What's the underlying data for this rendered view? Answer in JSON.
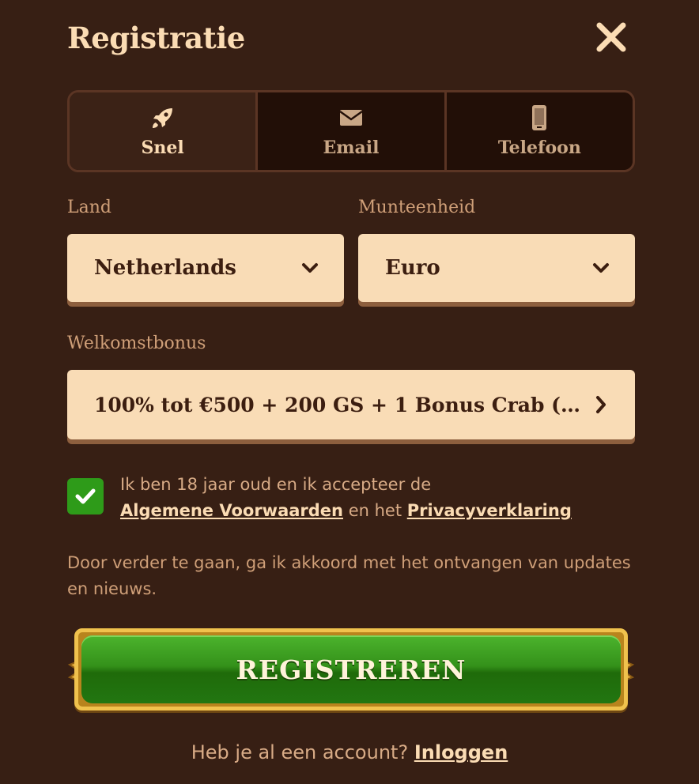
{
  "modal": {
    "title": "Registratie",
    "close_icon": "close-icon"
  },
  "tabs": [
    {
      "label": "Snel",
      "icon": "rocket-icon",
      "active": true
    },
    {
      "label": "Email",
      "icon": "envelope-icon",
      "active": false
    },
    {
      "label": "Telefoon",
      "icon": "phone-icon",
      "active": false
    }
  ],
  "form": {
    "country": {
      "label": "Land",
      "value": "Netherlands"
    },
    "currency": {
      "label": "Munteenheid",
      "value": "Euro"
    },
    "bonus": {
      "label": "Welkomstbonus",
      "value": "100% tot €500 + 200 GS + 1 Bonus Crab (ca..."
    }
  },
  "consent": {
    "checked": true,
    "text_prefix": "Ik ben 18 jaar oud en ik accepteer de",
    "terms_link": "Algemene Voorwaarden",
    "text_middle": "en het",
    "privacy_link": "Privacyverklaring"
  },
  "notice": "Door verder te gaan, ga ik akkoord met het ontvangen van updates en nieuws.",
  "register_button": "REGISTREREN",
  "login": {
    "prompt": "Heb je al een account?",
    "link": "Inloggen"
  },
  "colors": {
    "background": "#371f14",
    "accent_text": "#fbdcb4",
    "field_bg": "#f9dcb6",
    "checkbox": "#2e9b19",
    "button_green": "#34911a",
    "button_gold": "#f0c24d"
  }
}
